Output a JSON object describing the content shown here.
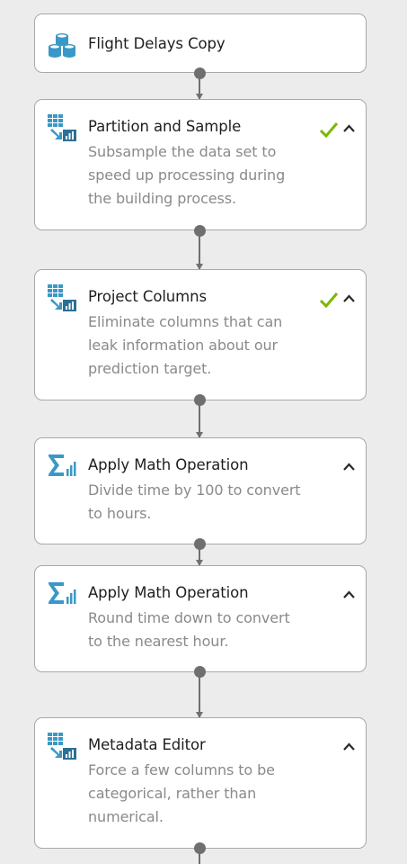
{
  "nodes": [
    {
      "title": "Flight Delays Copy",
      "icon": "database-icon",
      "lines": []
    },
    {
      "title": "Partition and Sample",
      "icon": "table-split-icon",
      "status": "check-icon",
      "lines": [
        "Subsample the data set to",
        "speed up processing during",
        "the building process."
      ]
    },
    {
      "title": "Project Columns",
      "icon": "table-split-icon",
      "status": "check-icon",
      "lines": [
        "Eliminate columns that can",
        "leak information about our",
        "prediction target."
      ]
    },
    {
      "title": "Apply Math Operation",
      "icon": "sigma-chart-icon",
      "lines": [
        "Divide time by 100 to convert",
        "to hours."
      ]
    },
    {
      "title": "Apply Math Operation",
      "icon": "sigma-chart-icon",
      "lines": [
        "Round time down to convert",
        "to the nearest hour."
      ]
    },
    {
      "title": "Metadata Editor",
      "icon": "table-split-icon",
      "lines": [
        "Force a few columns to be",
        "categorical, rather than",
        "numerical."
      ]
    }
  ],
  "colors": {
    "check": "#7ab800",
    "icon": "#3a98c6",
    "port": "#6f6f6f"
  }
}
